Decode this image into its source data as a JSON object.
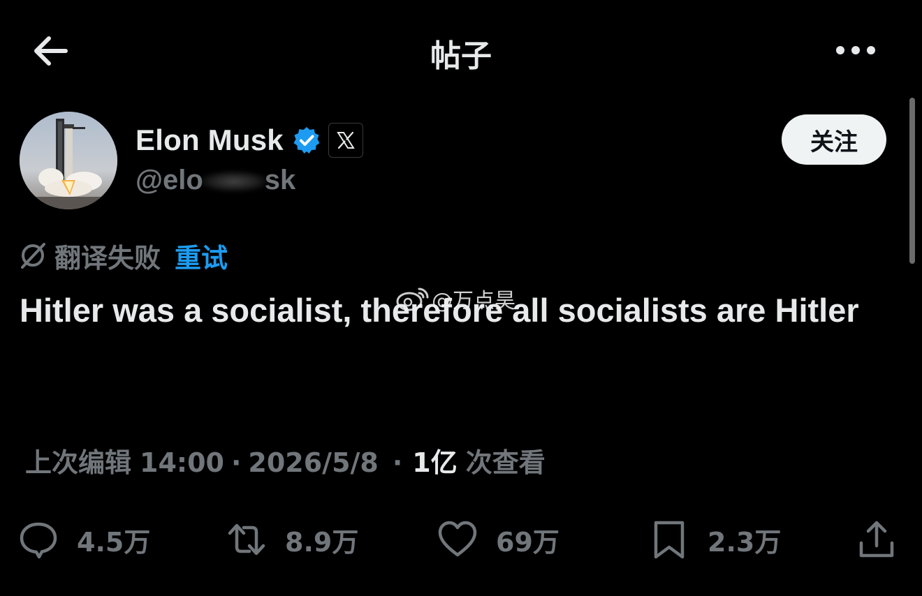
{
  "header": {
    "title": "帖子"
  },
  "author": {
    "name": "Elon Musk",
    "handle_start": "@elo",
    "handle_end": "sk",
    "follow_label": "关注"
  },
  "translation": {
    "status": "翻译失败",
    "retry_label": "重试"
  },
  "post": {
    "text": "Hitler was a socialist, therefore all socialists are Hitler"
  },
  "watermark": {
    "text": "@万点昊"
  },
  "meta": {
    "edited_label": "上次编辑",
    "time": "14:00",
    "date": "2026/5/8",
    "views": "1亿",
    "views_label": "次查看"
  },
  "actions": {
    "replies": "4.5万",
    "reposts": "8.9万",
    "likes": "69万",
    "bookmarks": "2.3万"
  },
  "colors": {
    "background": "#000000",
    "text_primary": "#e7e9ea",
    "text_secondary": "#71767b",
    "accent_blue": "#1d9bf0",
    "verified_blue": "#1d9bf0",
    "follow_button_bg": "#eff3f4"
  },
  "icons": {
    "back": "arrow-left-icon",
    "more": "more-horizontal-icon",
    "verified": "verified-badge-icon",
    "affiliate": "x-logo-icon",
    "translate_failed": "no-translation-icon",
    "reply": "comment-icon",
    "repost": "repost-icon",
    "like": "heart-icon",
    "bookmark": "bookmark-icon",
    "share": "share-icon"
  }
}
